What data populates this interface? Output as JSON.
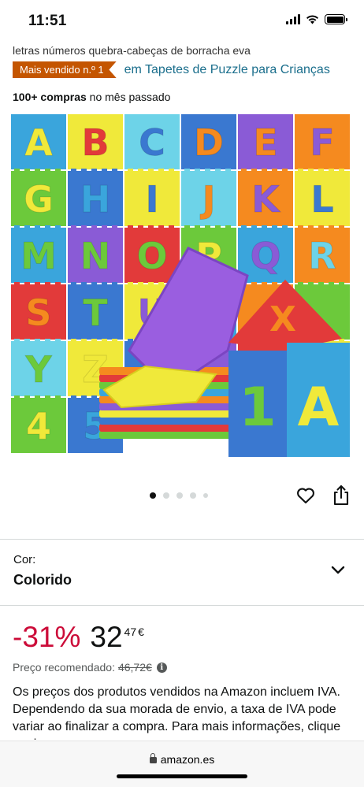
{
  "status_bar": {
    "time": "11:51",
    "battery_level": 1.0
  },
  "product": {
    "subtitle": "letras números quebra-cabeças de borracha eva",
    "badge": "Mais vendido n.º 1",
    "category_link": "em Tapetes de Puzzle para Crianças",
    "purchases_bold": "100+ compras",
    "purchases_rest": " no mês passado",
    "image_alt": "Tapete puzzle alfabeto A-Z e números",
    "mat_letters": [
      "A",
      "B",
      "C",
      "D",
      "E",
      "F",
      "G",
      "H",
      "I",
      "J",
      "K",
      "L",
      "M",
      "N",
      "O",
      "P",
      "Q",
      "R",
      "S",
      "T",
      "U",
      "",
      "",
      "",
      "Y",
      "Z",
      "",
      "",
      "",
      "",
      "4",
      "5"
    ],
    "stack_tiles": [
      "X",
      "1",
      "A"
    ]
  },
  "carousel": {
    "count": 5,
    "active": 0
  },
  "icons": {
    "heart": "heart-icon",
    "share": "share-icon",
    "chevron": "chevron-down-icon",
    "info": "info-icon",
    "lock": "lock-icon"
  },
  "color_selector": {
    "label": "Cor:",
    "value": "Colorido"
  },
  "price": {
    "discount": "-31%",
    "whole": "32",
    "cents": "47",
    "currency": "€",
    "recommended_label": "Preço recomendado:",
    "recommended_value": "46,72€",
    "info_glyph": "i"
  },
  "vat_note": "Os preços dos produtos vendidos na Amazon incluem IVA. Dependendo da sua morada de envio, a taxa de IVA pode variar ao finalizar a compra. Para mais informações, clique aqui.",
  "browser": {
    "domain": "amazon.es"
  },
  "colors": {
    "badge": "#c45500",
    "link": "#1a6e8c",
    "discount": "#cc0c39"
  }
}
